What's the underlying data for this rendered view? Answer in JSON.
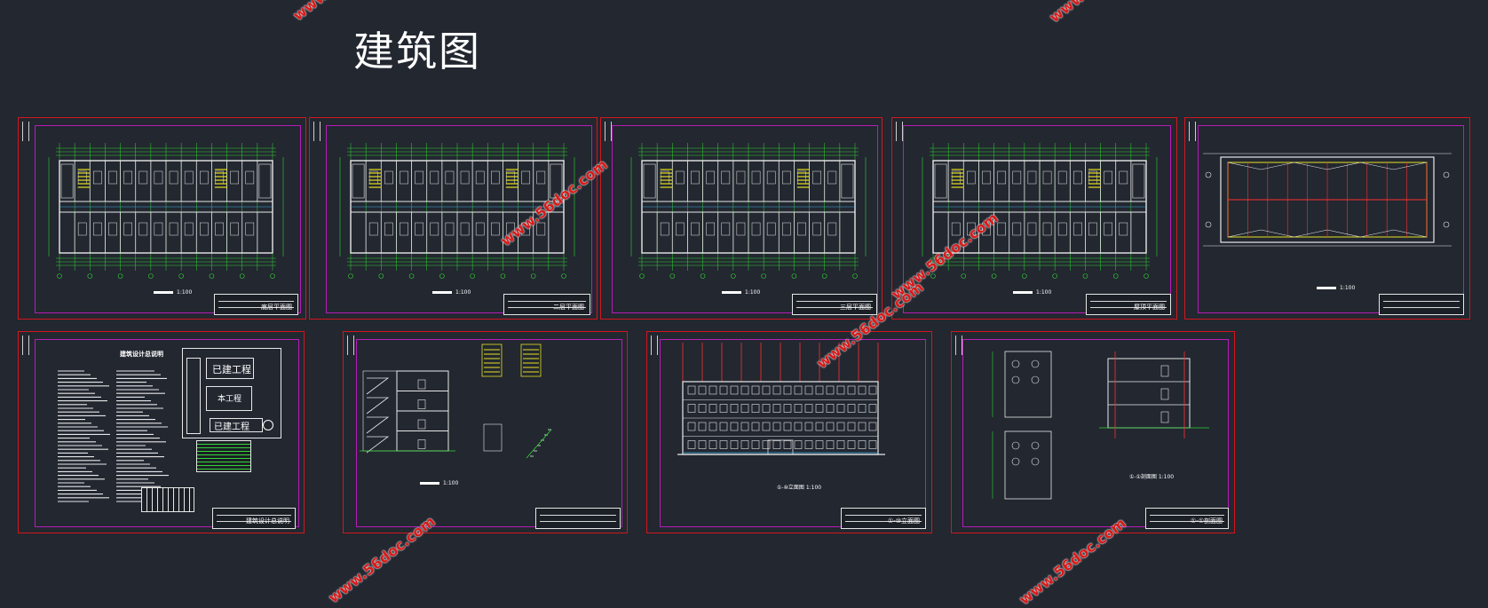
{
  "page": {
    "title": "建筑图",
    "background": "#222730"
  },
  "colors": {
    "sheet_border": "#d4161c",
    "inner_border": "#b81cb8",
    "dimension_lines": "#33d633",
    "walls": "#e8e8e8",
    "highlight": "#e8e020",
    "grid_axis": "#ff3030",
    "watermark": "#d81a1a"
  },
  "watermark": {
    "text": "www.56doc.com"
  },
  "sheets": [
    {
      "id": "sheet-1",
      "type": "floor-plan",
      "title_block": "底层平面图",
      "caption": "1:100"
    },
    {
      "id": "sheet-2",
      "type": "floor-plan",
      "title_block": "二层平面图",
      "caption": "1:100"
    },
    {
      "id": "sheet-3",
      "type": "floor-plan",
      "title_block": "三层平面图",
      "caption": "1:100"
    },
    {
      "id": "sheet-4",
      "type": "floor-plan",
      "title_block": "屋顶平面图",
      "caption": "1:100"
    },
    {
      "id": "sheet-5",
      "type": "roof-plan",
      "title_block": "",
      "caption": "1:100"
    },
    {
      "id": "sheet-6",
      "type": "design-notes",
      "title_block": "建筑设计总说明",
      "caption": "",
      "notes_title": "建筑设计总说明",
      "site_existing_1": "已建工程",
      "site_new": "本工程",
      "site_existing_2": "已建工程",
      "site_existing_3": "已建工程"
    },
    {
      "id": "sheet-7",
      "type": "section-stair",
      "title_block": "",
      "caption": "1:100"
    },
    {
      "id": "sheet-8",
      "type": "elevation",
      "title_block": "①-⑩立面图",
      "caption": "①-⑩立面图 1:100"
    },
    {
      "id": "sheet-9",
      "type": "detail",
      "title_block": "①-①剖面图",
      "caption": "①-①剖面图 1:100"
    }
  ]
}
